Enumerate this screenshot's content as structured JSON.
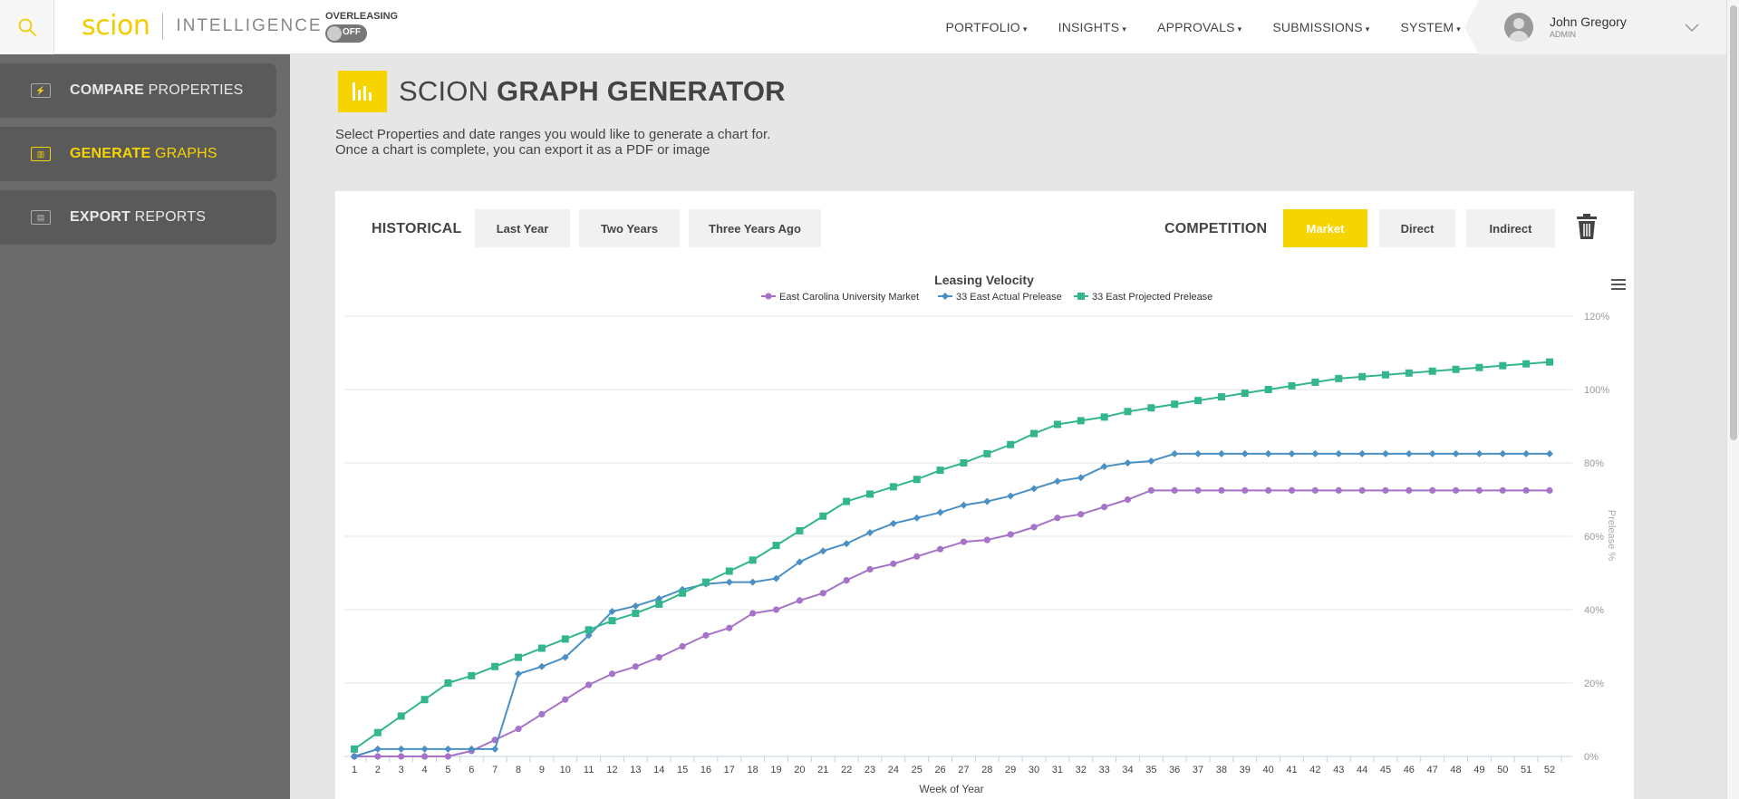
{
  "topbar": {
    "logo_brand": "scion",
    "logo_sub": "INTELLIGENCE",
    "overleasing_label": "OVERLEASING",
    "overleasing_state": "OFF",
    "nav": [
      "PORTFOLIO",
      "INSIGHTS",
      "APPROVALS",
      "SUBMISSIONS",
      "SYSTEM"
    ],
    "user_name": "John Gregory",
    "user_role": "ADMIN"
  },
  "sidebar": {
    "items": [
      {
        "bold": "COMPARE",
        "rest": " PROPERTIES",
        "active": false
      },
      {
        "bold": "GENERATE",
        "rest": " GRAPHS",
        "active": true
      },
      {
        "bold": "EXPORT",
        "rest": " REPORTS",
        "active": false
      }
    ]
  },
  "page": {
    "title_light": "SCION ",
    "title_bold": "GRAPH GENERATOR",
    "desc_line1": "Select Properties and date ranges you would like to generate a chart for.",
    "desc_line2": "Once a chart is complete, you can export it as a PDF or image"
  },
  "controls": {
    "historical_label": "HISTORICAL",
    "historical_buttons": [
      "Last Year",
      "Two Years",
      "Three Years Ago"
    ],
    "competition_label": "COMPETITION",
    "competition_buttons": [
      "Market",
      "Direct",
      "Indirect"
    ],
    "competition_active": "Market"
  },
  "colors": {
    "accent": "#f6d400",
    "series_market": "#a673c8",
    "series_actual": "#4a90c4",
    "series_projected": "#33b58e"
  },
  "chart_data": {
    "type": "line",
    "title": "Leasing Velocity",
    "xlabel": "Week of Year",
    "ylabel": "Prelease %",
    "x": [
      1,
      2,
      3,
      4,
      5,
      6,
      7,
      8,
      9,
      10,
      11,
      12,
      13,
      14,
      15,
      16,
      17,
      18,
      19,
      20,
      21,
      22,
      23,
      24,
      25,
      26,
      27,
      28,
      29,
      30,
      31,
      32,
      33,
      34,
      35,
      36,
      37,
      38,
      39,
      40,
      41,
      42,
      43,
      44,
      45,
      46,
      47,
      48,
      49,
      50,
      51,
      52
    ],
    "ylim": [
      0,
      120
    ],
    "yticks": [
      "0%",
      "20%",
      "40%",
      "60%",
      "80%",
      "100%",
      "120%"
    ],
    "legend_position": "top-center",
    "grid": true,
    "series": [
      {
        "name": "East Carolina University Market",
        "marker": "circle",
        "values": [
          0,
          0,
          0,
          0,
          0,
          1.5,
          4.5,
          7.5,
          11.5,
          15.5,
          19.5,
          22.5,
          24.5,
          27,
          30,
          33,
          35,
          39,
          40,
          42.5,
          44.5,
          48,
          51,
          52.5,
          54.5,
          56.5,
          58.5,
          59,
          60.5,
          62.5,
          65,
          66,
          68,
          70,
          72.5,
          72.5,
          72.5,
          72.5,
          72.5,
          72.5,
          72.5,
          72.5,
          72.5,
          72.5,
          72.5,
          72.5,
          72.5,
          72.5,
          72.5,
          72.5,
          72.5,
          72.5
        ]
      },
      {
        "name": "33 East Actual Prelease",
        "marker": "diamond",
        "values": [
          0,
          2,
          2,
          2,
          2,
          2,
          2,
          22.5,
          24.5,
          27,
          33,
          39.5,
          41,
          43,
          45.5,
          47,
          47.5,
          47.5,
          48.5,
          53,
          56,
          58,
          61,
          63.5,
          65,
          66.5,
          68.5,
          69.5,
          71,
          73,
          75,
          76,
          79,
          80,
          80.5,
          82.5,
          82.5,
          82.5,
          82.5,
          82.5,
          82.5,
          82.5,
          82.5,
          82.5,
          82.5,
          82.5,
          82.5,
          82.5,
          82.5,
          82.5,
          82.5,
          82.5
        ]
      },
      {
        "name": "33 East Projected Prelease",
        "marker": "square",
        "values": [
          2,
          6.5,
          11,
          15.5,
          20,
          22,
          24.5,
          27,
          29.5,
          32,
          34.5,
          37,
          39,
          41.5,
          44.5,
          47.5,
          50.5,
          53.5,
          57.5,
          61.5,
          65.5,
          69.5,
          71.5,
          73.5,
          75.5,
          78,
          80,
          82.5,
          85,
          88,
          90.5,
          91.5,
          92.5,
          94,
          95,
          96,
          97,
          98,
          99,
          100,
          101,
          102,
          103,
          103.5,
          104,
          104.5,
          105,
          105.5,
          106,
          106.5,
          107,
          107.5
        ]
      }
    ]
  }
}
